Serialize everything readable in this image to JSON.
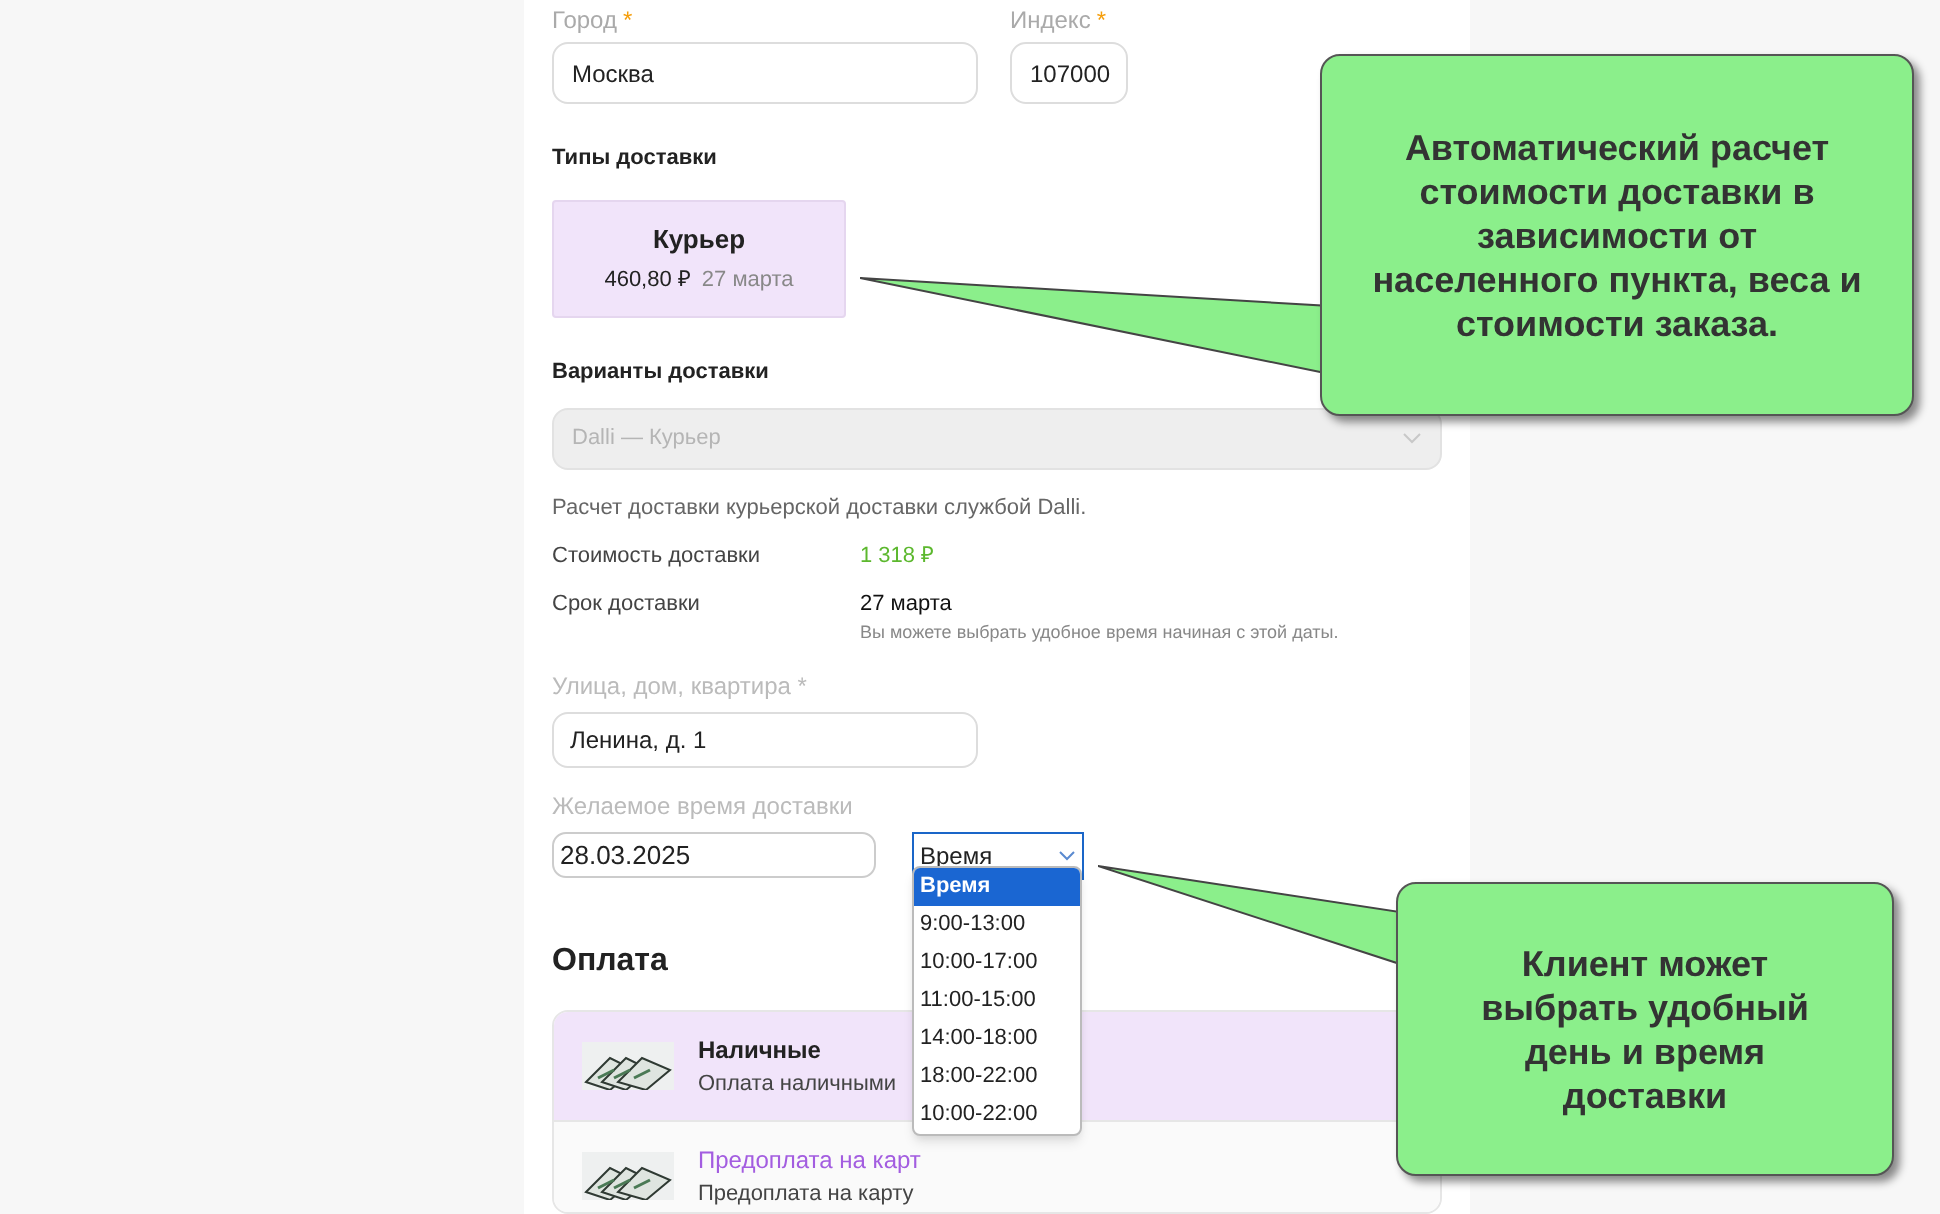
{
  "city": {
    "label": "Город",
    "required_mark": "*",
    "value": "Москва"
  },
  "zip": {
    "label": "Индекс",
    "required_mark": "*",
    "value": "107000"
  },
  "delivery_types": {
    "title": "Типы доставки",
    "items": [
      {
        "name": "Курьер",
        "price": "460,80 ₽",
        "date": "27 марта",
        "selected": true
      }
    ]
  },
  "delivery_options": {
    "title": "Варианты доставки",
    "value": "Dalli — Курьер",
    "disabled": true
  },
  "description": "Расчет доставки курьерской доставки службой Dalli.",
  "details": [
    {
      "label": "Стоимость доставки",
      "value": "1 318 ₽",
      "kind": "price"
    },
    {
      "label": "Срок доставки",
      "value": "27 марта",
      "hint": "Вы можете выбрать удобное время начиная с этой даты.",
      "kind": "date"
    }
  ],
  "street": {
    "label": "Улица, дом, квартира *",
    "value": "Ленина, д. 1"
  },
  "time": {
    "label": "Желаемое время доставки",
    "date": "28.03.2025",
    "select": "Время",
    "options": [
      {
        "label": "Время",
        "selected": true
      },
      {
        "label": "9:00-13:00",
        "selected": false
      },
      {
        "label": "10:00-17:00",
        "selected": false
      },
      {
        "label": "11:00-15:00",
        "selected": false
      },
      {
        "label": "14:00-18:00",
        "selected": false
      },
      {
        "label": "18:00-22:00",
        "selected": false
      },
      {
        "label": "10:00-22:00",
        "selected": false
      }
    ]
  },
  "payment": {
    "title": "Оплата",
    "items": [
      {
        "name": "Наличные",
        "description": "Оплата наличными",
        "selected": true
      },
      {
        "name": "Предоплата на карт",
        "description": "Предоплата на карту",
        "selected": false
      }
    ]
  },
  "callouts": [
    "Автоматический расчет стоимости доставки в зависимости от населенного пункта, веса и стоимости заказа.",
    "Клиент может выбрать удобный день и время доставки"
  ]
}
